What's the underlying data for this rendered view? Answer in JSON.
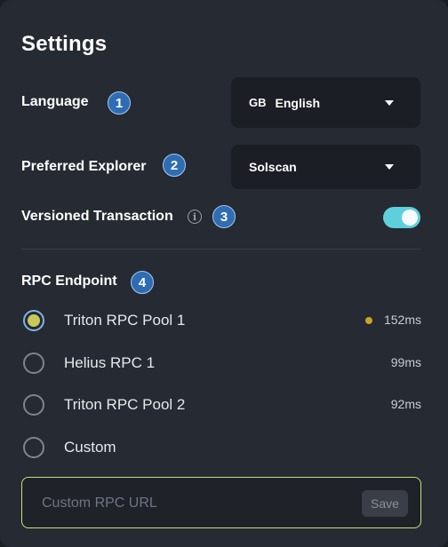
{
  "settings": {
    "title": "Settings",
    "language": {
      "label": "Language",
      "badge": "1",
      "flag": "GB",
      "value": "English"
    },
    "explorer": {
      "label": "Preferred Explorer",
      "badge": "2",
      "value": "Solscan"
    },
    "versioned": {
      "label": "Versioned Transaction",
      "badge": "3",
      "info_glyph": "i",
      "enabled": true
    },
    "rpc": {
      "label": "RPC Endpoint",
      "badge": "4",
      "options": [
        {
          "name": "Triton RPC Pool 1",
          "latency": "152ms",
          "selected": true,
          "status_color": "#c9a227"
        },
        {
          "name": "Helius RPC 1",
          "latency": "99ms",
          "selected": false
        },
        {
          "name": "Triton RPC Pool 2",
          "latency": "92ms",
          "selected": false
        },
        {
          "name": "Custom",
          "latency": "",
          "selected": false
        }
      ],
      "custom_placeholder": "Custom RPC URL",
      "save_label": "Save"
    }
  },
  "colors": {
    "accent_toggle": "#5ed0dc",
    "badge": "#2f6db3",
    "custom_border": "#c7e07a"
  }
}
